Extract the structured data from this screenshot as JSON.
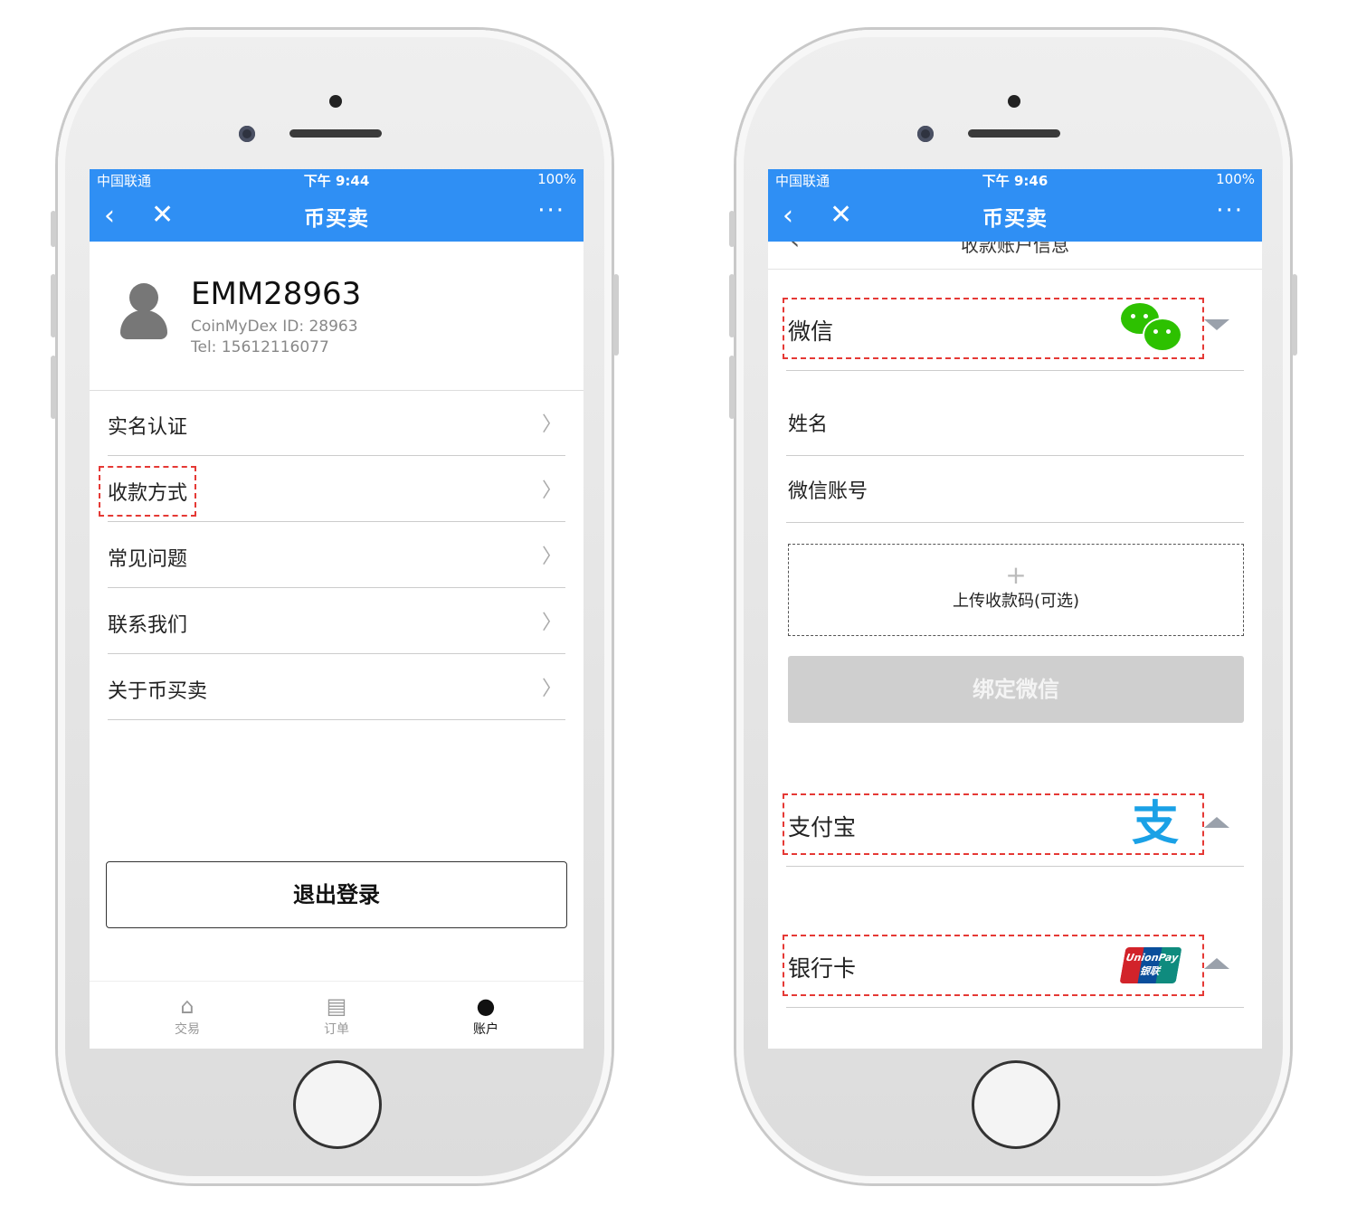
{
  "left": {
    "status": {
      "carrier": "中国联通",
      "time": "下午 9:44",
      "battery": "100%"
    },
    "nav": {
      "title": "币买卖",
      "back": "‹",
      "close": "✕",
      "more": "···"
    },
    "profile": {
      "username": "EMM28963",
      "id_line": "CoinMyDex ID: 28963",
      "tel_line": "Tel: 15612116077"
    },
    "menu": [
      {
        "label": "实名认证"
      },
      {
        "label": "收款方式"
      },
      {
        "label": "常见问题"
      },
      {
        "label": "联系我们"
      },
      {
        "label": "关于币买卖"
      }
    ],
    "logout": "退出登录",
    "tabs": [
      {
        "label": "交易",
        "icon": "home-icon"
      },
      {
        "label": "订单",
        "icon": "orders-icon"
      },
      {
        "label": "账户",
        "icon": "user-icon"
      }
    ]
  },
  "right": {
    "status": {
      "carrier": "中国联通",
      "time": "下午 9:46",
      "battery": "100%"
    },
    "nav": {
      "title": "币买卖",
      "back": "‹",
      "close": "✕",
      "more": "···"
    },
    "subheader": "收款账户信息",
    "wechat": {
      "title": "微信",
      "fields": [
        "姓名",
        "微信账号"
      ],
      "upload": "上传收款码(可选)",
      "bind": "绑定微信"
    },
    "alipay": {
      "title": "支付宝"
    },
    "bank": {
      "title": "银行卡",
      "card_text_1": "UnionPay",
      "card_text_2": "银联"
    }
  },
  "colors": {
    "accent": "#2f8ff4",
    "highlight": "#e53935",
    "disabled": "#cfcfcf"
  }
}
